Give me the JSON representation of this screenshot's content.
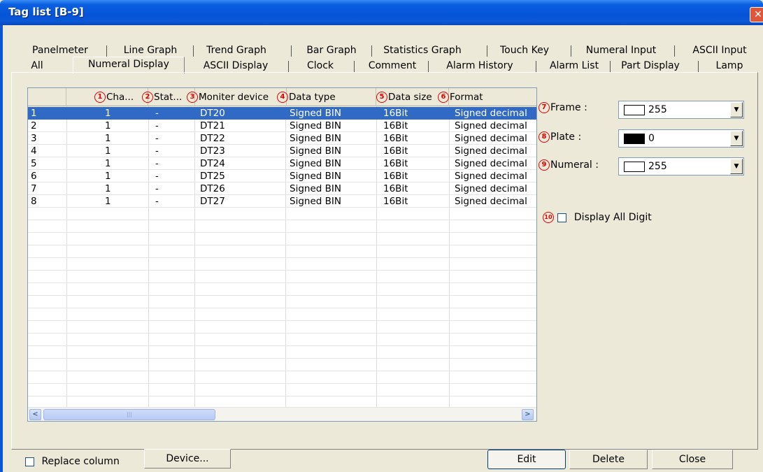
{
  "window": {
    "title": "Tag list [B-9]",
    "close_glyph": "✕"
  },
  "tabs_top": [
    "Panelmeter",
    "Line Graph",
    "Trend Graph",
    "Bar Graph",
    "Statistics Graph",
    "Touch Key",
    "Numeral Input",
    "ASCII Input"
  ],
  "tabs_bottom": [
    "All",
    "Numeral Display",
    "ASCII Display",
    "Clock",
    "Comment",
    "Alarm History",
    "Alarm List",
    "Part Display",
    "Lamp"
  ],
  "active_tab": "Numeral Display",
  "table": {
    "headers": [
      {
        "num": "",
        "label": ""
      },
      {
        "num": "1",
        "label": "Cha..."
      },
      {
        "num": "2",
        "label": "Stat..."
      },
      {
        "num": "3",
        "label": "Moniter device"
      },
      {
        "num": "4",
        "label": "Data type"
      },
      {
        "num": "5",
        "label": "Data size"
      },
      {
        "num": "6",
        "label": "Format"
      }
    ],
    "rows": [
      [
        "1",
        "1",
        "-",
        "DT20",
        "Signed BIN",
        "16Bit",
        "Signed decimal"
      ],
      [
        "2",
        "1",
        "-",
        "DT21",
        "Signed BIN",
        "16Bit",
        "Signed decimal"
      ],
      [
        "3",
        "1",
        "-",
        "DT22",
        "Signed BIN",
        "16Bit",
        "Signed decimal"
      ],
      [
        "4",
        "1",
        "-",
        "DT23",
        "Signed BIN",
        "16Bit",
        "Signed decimal"
      ],
      [
        "5",
        "1",
        "-",
        "DT24",
        "Signed BIN",
        "16Bit",
        "Signed decimal"
      ],
      [
        "6",
        "1",
        "-",
        "DT25",
        "Signed BIN",
        "16Bit",
        "Signed decimal"
      ],
      [
        "7",
        "1",
        "-",
        "DT26",
        "Signed BIN",
        "16Bit",
        "Signed decimal"
      ],
      [
        "8",
        "1",
        "-",
        "DT27",
        "Signed BIN",
        "16Bit",
        "Signed decimal"
      ]
    ],
    "selected_row": 0,
    "scroll_left": "<",
    "scroll_right": ">",
    "scroll_thumb_grip": "|||"
  },
  "props": {
    "frame": {
      "num": "7",
      "label": "Frame :",
      "value": "255",
      "swatch": "#ffffff"
    },
    "plate": {
      "num": "8",
      "label": "Plate :",
      "value": "0",
      "swatch": "#000000"
    },
    "numeral": {
      "num": "9",
      "label": "Numeral :",
      "value": "255",
      "swatch": "#ffffff"
    },
    "display_all_digit": {
      "num": "10",
      "label": "Display All Digit",
      "checked": false
    },
    "combo_arrow": "▼"
  },
  "footer": {
    "replace_column": {
      "label": "Replace column",
      "checked": false
    },
    "device_button": "Device...",
    "edit_button": "Edit",
    "delete_button": "Delete",
    "close_button": "Close"
  },
  "colors": {
    "title_bar": "#0554d8",
    "selection": "#316ac5",
    "marker_red": "#e60000",
    "window_bg": "#ece9d8"
  }
}
